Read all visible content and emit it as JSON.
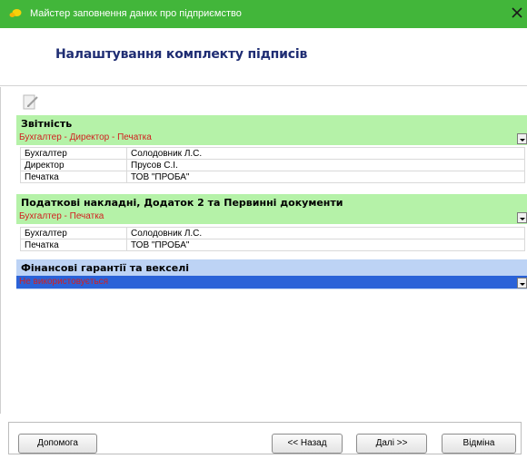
{
  "window": {
    "title": "Майстер заповнення даних про підприємство",
    "close_icon": "close-icon",
    "accent": "#42b63a"
  },
  "header": {
    "title": "Налаштування комплекту підписів"
  },
  "toolbar": {
    "edit_icon": "edit-signature-icon"
  },
  "sections": [
    {
      "title": "Звітність",
      "value": "Бухгалтер - Директор - Печатка",
      "color": "#b5f2a8",
      "rows": [
        {
          "role": "Бухгалтер",
          "signer": "Солодовник Л.С."
        },
        {
          "role": "Директор",
          "signer": "Прусов С.І."
        },
        {
          "role": "Печатка",
          "signer": "ТОВ \"ПРОБА\""
        }
      ]
    },
    {
      "title": "Податкові накладні, Додаток 2 та Первинні документи",
      "value": "Бухгалтер - Печатка",
      "color": "#b5f2a8",
      "rows": [
        {
          "role": "Бухгалтер",
          "signer": "Солодовник Л.С."
        },
        {
          "role": "Печатка",
          "signer": "ТОВ \"ПРОБА\""
        }
      ]
    },
    {
      "title": "Фінансові гарантії та векселі",
      "value": "Не використовується",
      "color": "#bdd3f5",
      "selected": true,
      "rows": []
    }
  ],
  "footer": {
    "help_label": "Допомога",
    "back_label": "<< Назад",
    "next_label": "Далі >>",
    "cancel_label": "Відміна"
  }
}
